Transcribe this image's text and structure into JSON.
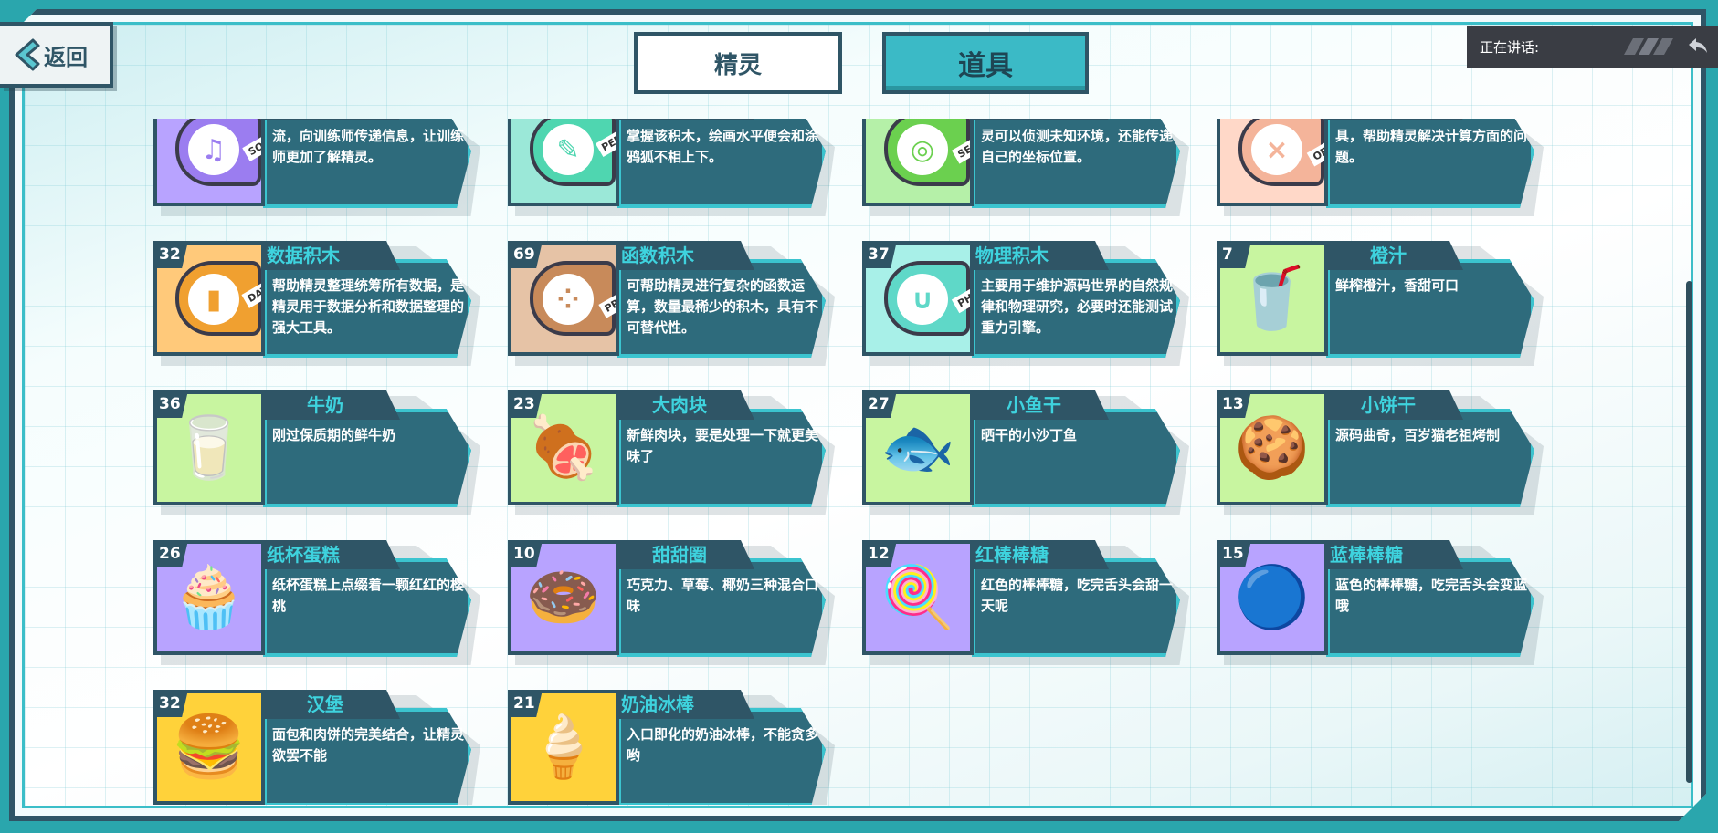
{
  "header": {
    "back_label": "返回",
    "tabs": [
      {
        "label": "精灵",
        "active": false
      },
      {
        "label": "道具",
        "active": true
      }
    ],
    "speaker_label": "正在讲话:"
  },
  "colors": {
    "frame": "#2f5566",
    "accent": "#3bc4cf",
    "card_body": "#2e6b7c",
    "name_text": "#3ed3de",
    "teal_bg": "#2aa6ad"
  },
  "items": [
    {
      "count": "",
      "name": "",
      "desc": "流，向训练师传递信息，让训练师更加了解精灵。",
      "icon": "sound-block-icon",
      "bg": "#b8a3ff",
      "kind": "block",
      "block_color": "#9b7df0",
      "block_label": "SOUND",
      "symbol": "♫"
    },
    {
      "count": "",
      "name": "",
      "desc": "掌握该积木，绘画水平便会和涂鸦狐不相上下。",
      "icon": "pen-block-icon",
      "bg": "#9be8d8",
      "kind": "block",
      "block_color": "#4fd6b0",
      "block_label": "PEN",
      "symbol": "✎"
    },
    {
      "count": "",
      "name": "",
      "desc": "灵可以侦测未知环境，还能传递自己的坐标位置。",
      "icon": "sensing-block-icon",
      "bg": "#b5f0a8",
      "kind": "block",
      "block_color": "#6bd04f",
      "block_label": "SENSING",
      "symbol": "◎"
    },
    {
      "count": "",
      "name": "",
      "desc": "具，帮助精灵解决计算方面的问题。",
      "icon": "operator-block-icon",
      "bg": "#ffd8c8",
      "kind": "block",
      "block_color": "#f4b49a",
      "block_label": "OPERATOR",
      "symbol": "×"
    },
    {
      "count": "32",
      "name": "数据积木",
      "desc": "帮助精灵整理统筹所有数据，是精灵用于数据分析和数据整理的强大工具。",
      "icon": "data-block-icon",
      "bg": "#ffc97a",
      "kind": "block",
      "block_color": "#f0a030",
      "block_label": "DATA",
      "symbol": "▮"
    },
    {
      "count": "69",
      "name": "函数积木",
      "desc": "可帮助精灵进行复杂的函数运算，数量最稀少的积木，具有不可替代性。",
      "icon": "procedure-block-icon",
      "bg": "#e6c3a6",
      "kind": "block",
      "block_color": "#c88a5a",
      "block_label": "PROCEDURE",
      "symbol": "⁘"
    },
    {
      "count": "37",
      "name": "物理积木",
      "desc": "主要用于维护源码世界的自然规律和物理研究，必要时还能测试重力引擎。",
      "icon": "physics-block-icon",
      "bg": "#a8f0e8",
      "kind": "block",
      "block_color": "#5fd8c8",
      "block_label": "PHYSICS",
      "symbol": "∪"
    },
    {
      "count": "7",
      "name": "橙汁",
      "desc": "鲜榨橙汁，香甜可口",
      "icon": "orange-juice-icon",
      "bg": "#c8f5a0",
      "kind": "emoji",
      "symbol": "🥤"
    },
    {
      "count": "36",
      "name": "牛奶",
      "desc": "刚过保质期的鲜牛奶",
      "icon": "milk-carton-icon",
      "bg": "#c8f5a0",
      "kind": "emoji",
      "symbol": "🥛"
    },
    {
      "count": "23",
      "name": "大肉块",
      "desc": "新鲜肉块，要是处理一下就更美味了",
      "icon": "meat-icon",
      "bg": "#c8f5a0",
      "kind": "emoji",
      "symbol": "🍖"
    },
    {
      "count": "27",
      "name": "小鱼干",
      "desc": "晒干的小沙丁鱼",
      "icon": "dried-fish-icon",
      "bg": "#c8f5a0",
      "kind": "emoji",
      "symbol": "🐟"
    },
    {
      "count": "13",
      "name": "小饼干",
      "desc": "源码曲奇，百岁猫老祖烤制",
      "icon": "cookies-icon",
      "bg": "#c8f5a0",
      "kind": "emoji",
      "symbol": "🍪"
    },
    {
      "count": "26",
      "name": "纸杯蛋糕",
      "desc": "纸杯蛋糕上点缀着一颗红红的樱桃",
      "icon": "cupcake-icon",
      "bg": "#b8a3ff",
      "kind": "emoji",
      "symbol": "🧁"
    },
    {
      "count": "10",
      "name": "甜甜圈",
      "desc": "巧克力、草莓、椰奶三种混合口味",
      "icon": "donut-icon",
      "bg": "#b8a3ff",
      "kind": "emoji",
      "symbol": "🍩"
    },
    {
      "count": "12",
      "name": "红棒棒糖",
      "desc": "红色的棒棒糖，吃完舌头会甜一天呢",
      "icon": "red-lollipop-icon",
      "bg": "#b8a3ff",
      "kind": "emoji",
      "symbol": "🍭"
    },
    {
      "count": "15",
      "name": "蓝棒棒糖",
      "desc": "蓝色的棒棒糖，吃完舌头会变蓝哦",
      "icon": "blue-lollipop-icon",
      "bg": "#b8a3ff",
      "kind": "emoji",
      "symbol": "🔵"
    },
    {
      "count": "32",
      "name": "汉堡",
      "desc": "面包和肉饼的完美结合，让精灵欲罢不能",
      "icon": "hamburger-icon",
      "bg": "#ffd23a",
      "kind": "emoji",
      "symbol": "🍔"
    },
    {
      "count": "21",
      "name": "奶油冰棒",
      "desc": "入口即化的奶油冰棒，不能贪多哟",
      "icon": "ice-cream-bar-icon",
      "bg": "#ffd23a",
      "kind": "emoji",
      "symbol": "🍦"
    }
  ]
}
